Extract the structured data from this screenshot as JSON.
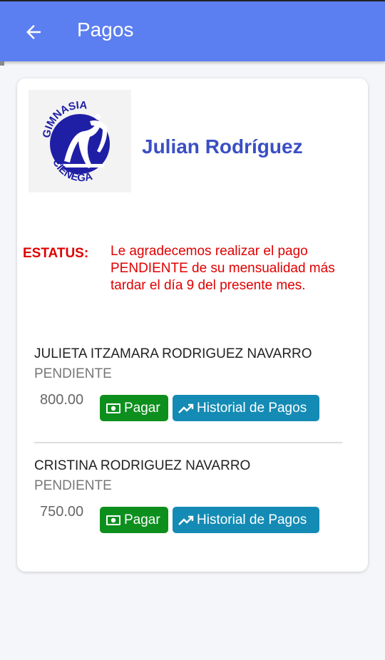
{
  "appbar": {
    "title": "Pagos",
    "back_icon": "arrow-left-icon"
  },
  "profile": {
    "logo_top_text": "GIMNASIA",
    "logo_bottom_text": "CIENEGA",
    "name": "Julian Rodríguez"
  },
  "status": {
    "label": "ESTATUS:",
    "message": "Le agradecemos realizar el pago PENDIENTE de su mensualidad más tardar el día 9 del presente mes."
  },
  "members": [
    {
      "name": "JULIETA ITZAMARA RODRIGUEZ NAVARRO",
      "status": "PENDIENTE",
      "amount": "800.00",
      "pay_label": "Pagar",
      "history_label": "Historial de Pagos"
    },
    {
      "name": "CRISTINA RODRIGUEZ NAVARRO",
      "status": "PENDIENTE",
      "amount": "750.00",
      "pay_label": "Pagar",
      "history_label": "Historial de Pagos"
    }
  ],
  "colors": {
    "appbar": "#5b7ef0",
    "name": "#3a4fc5",
    "status": "#e00000",
    "pay_button": "#0d8f1e",
    "history_button": "#148bb4"
  }
}
